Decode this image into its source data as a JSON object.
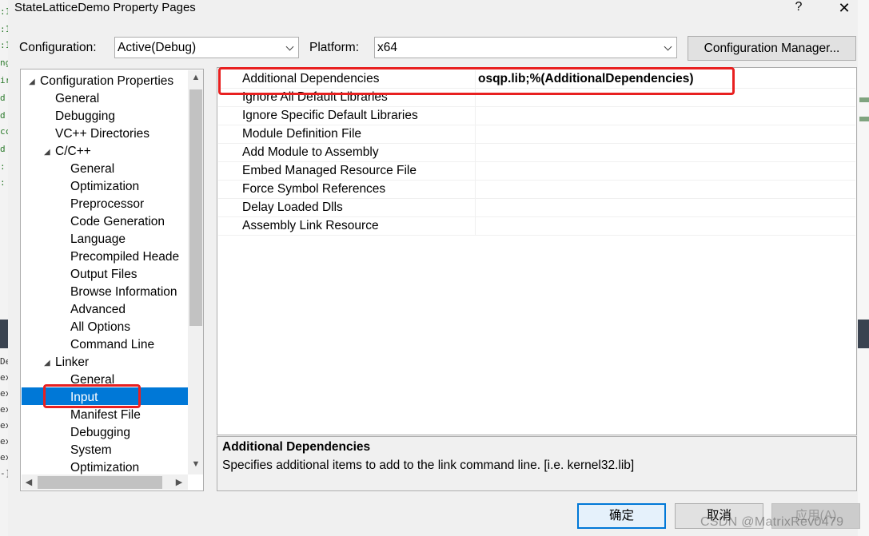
{
  "window": {
    "title": "StateLatticeDemo Property Pages",
    "help_glyph": "?",
    "close_glyph": "✕"
  },
  "config_row": {
    "configuration_label": "Configuration:",
    "configuration_value": "Active(Debug)",
    "platform_label": "Platform:",
    "platform_value": "x64",
    "manager_button": "Configuration Manager..."
  },
  "tree": {
    "items": [
      {
        "label": "Configuration Properties",
        "expander": "◢"
      },
      {
        "label": "General"
      },
      {
        "label": "Debugging"
      },
      {
        "label": "VC++ Directories"
      },
      {
        "label": "C/C++",
        "expander": "◢"
      },
      {
        "label": "General"
      },
      {
        "label": "Optimization"
      },
      {
        "label": "Preprocessor"
      },
      {
        "label": "Code Generation"
      },
      {
        "label": "Language"
      },
      {
        "label": "Precompiled Heade"
      },
      {
        "label": "Output Files"
      },
      {
        "label": "Browse Information"
      },
      {
        "label": "Advanced"
      },
      {
        "label": "All Options"
      },
      {
        "label": "Command Line"
      },
      {
        "label": "Linker",
        "expander": "◢"
      },
      {
        "label": "General"
      },
      {
        "label": "Input",
        "selected": true
      },
      {
        "label": "Manifest File"
      },
      {
        "label": "Debugging"
      },
      {
        "label": "System"
      },
      {
        "label": "Optimization"
      }
    ]
  },
  "grid": {
    "rows": [
      {
        "name": "Additional Dependencies",
        "value": "osqp.lib;%(AdditionalDependencies)",
        "bold": true
      },
      {
        "name": "Ignore All Default Libraries",
        "value": ""
      },
      {
        "name": "Ignore Specific Default Libraries",
        "value": ""
      },
      {
        "name": "Module Definition File",
        "value": ""
      },
      {
        "name": "Add Module to Assembly",
        "value": ""
      },
      {
        "name": "Embed Managed Resource File",
        "value": ""
      },
      {
        "name": "Force Symbol References",
        "value": ""
      },
      {
        "name": "Delay Loaded Dlls",
        "value": ""
      },
      {
        "name": "Assembly Link Resource",
        "value": ""
      }
    ]
  },
  "description": {
    "title": "Additional Dependencies",
    "text": "Specifies additional items to add to the link command line. [i.e. kernel32.lib]"
  },
  "buttons": {
    "ok": "确定",
    "cancel": "取消",
    "apply": "应用(A)"
  },
  "watermark": "CSDN @MatrixRev0479",
  "colors": {
    "selection": "#0078d7",
    "highlight_box": "#e82020"
  }
}
